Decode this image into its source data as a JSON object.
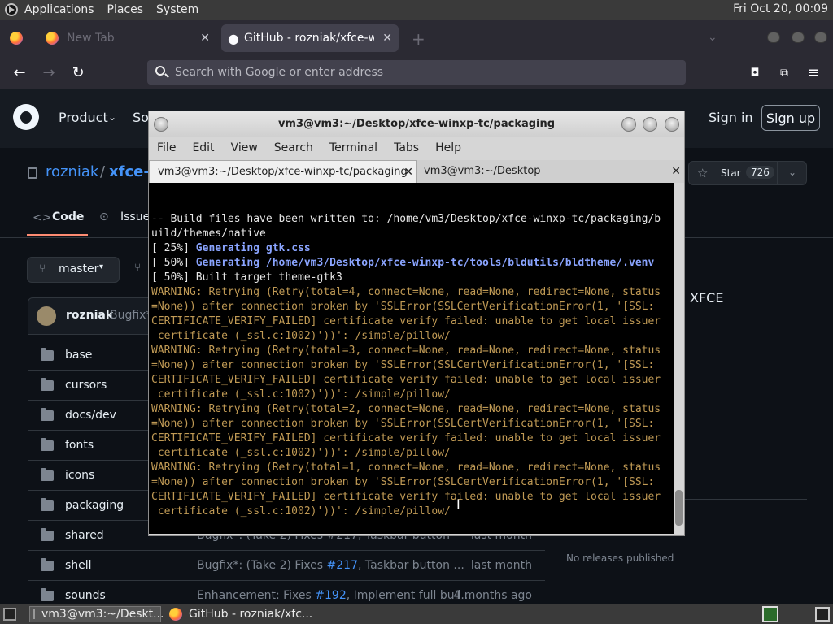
{
  "system_panel": {
    "menus": [
      "Applications",
      "Places",
      "System"
    ],
    "clock": "Fri Oct 20, 00:09"
  },
  "browser": {
    "tabs": [
      {
        "label": "New Tab"
      },
      {
        "label": "GitHub - rozniak/xfce-winxp"
      }
    ],
    "urlbar_placeholder": "Search with Google or enter address"
  },
  "github": {
    "nav": {
      "product": "Product",
      "solutions": "So",
      "sign_in": "Sign in",
      "sign_up": "Sign up"
    },
    "repo": {
      "owner": "rozniak",
      "sep": "/",
      "name": "xfce-"
    },
    "star": {
      "label": "Star",
      "count": "726"
    },
    "tabs": {
      "code": "Code",
      "issues": "Issue"
    },
    "branch": "master",
    "commit": {
      "author": "rozniak",
      "message": "Bugfix*:"
    },
    "about_fragment": "XFCE",
    "releases": "No releases published",
    "files": [
      {
        "name": "base",
        "msg": "",
        "when": ""
      },
      {
        "name": "cursors",
        "msg": "",
        "when": ""
      },
      {
        "name": "docs/dev",
        "msg": "",
        "when": ""
      },
      {
        "name": "fonts",
        "msg": "",
        "when": ""
      },
      {
        "name": "icons",
        "msg": "",
        "when": ""
      },
      {
        "name": "packaging",
        "msg": "",
        "when": ""
      },
      {
        "name": "shared",
        "msg": "Bugfix*: (Take 2) Fixes #217, Taskbar button",
        "when": "last month"
      },
      {
        "name": "shell",
        "msg_pre": "Bugfix*: (Take 2) Fixes ",
        "msg_link": "#217",
        "msg_post": ", Taskbar button ...",
        "when": "last month"
      },
      {
        "name": "sounds",
        "msg_pre": "Enhancement: Fixes ",
        "msg_link": "#192",
        "msg_post": ", Implement full buil...",
        "when": "4 months ago"
      }
    ]
  },
  "terminal": {
    "title": "vm3@vm3:~/Desktop/xfce-winxp-tc/packaging",
    "menu": [
      "File",
      "Edit",
      "View",
      "Search",
      "Terminal",
      "Tabs",
      "Help"
    ],
    "tabs": [
      "vm3@vm3:~/Desktop/xfce-winxp-tc/packaging",
      "vm3@vm3:~/Desktop"
    ],
    "lines": [
      {
        "t": "",
        "c": ""
      },
      {
        "t": "",
        "c": ""
      },
      {
        "t": "-- Build files have been written to: /home/vm3/Desktop/xfce-winxp-tc/packaging/b",
        "c": ""
      },
      {
        "t": "uild/themes/native",
        "c": ""
      },
      {
        "t": "[ 25%] ",
        "g": "Generating gtk.css",
        "c": ""
      },
      {
        "t": "[ 50%] ",
        "g": "Generating /home/vm3/Desktop/xfce-winxp-tc/tools/bldutils/bldtheme/.venv",
        "c": ""
      },
      {
        "t": "[ 50%] Built target theme-gtk3",
        "c": ""
      },
      {
        "t": "WARNING: Retrying (Retry(total=4, connect=None, read=None, redirect=None, status",
        "c": "warn"
      },
      {
        "t": "=None)) after connection broken by 'SSLError(SSLCertVerificationError(1, '[SSL:",
        "c": "warn"
      },
      {
        "t": "CERTIFICATE_VERIFY_FAILED] certificate verify failed: unable to get local issuer",
        "c": "warn"
      },
      {
        "t": " certificate (_ssl.c:1002)'))': /simple/pillow/",
        "c": "warn"
      },
      {
        "t": "WARNING: Retrying (Retry(total=3, connect=None, read=None, redirect=None, status",
        "c": "warn"
      },
      {
        "t": "=None)) after connection broken by 'SSLError(SSLCertVerificationError(1, '[SSL:",
        "c": "warn"
      },
      {
        "t": "CERTIFICATE_VERIFY_FAILED] certificate verify failed: unable to get local issuer",
        "c": "warn"
      },
      {
        "t": " certificate (_ssl.c:1002)'))': /simple/pillow/",
        "c": "warn"
      },
      {
        "t": "WARNING: Retrying (Retry(total=2, connect=None, read=None, redirect=None, status",
        "c": "warn"
      },
      {
        "t": "=None)) after connection broken by 'SSLError(SSLCertVerificationError(1, '[SSL:",
        "c": "warn"
      },
      {
        "t": "CERTIFICATE_VERIFY_FAILED] certificate verify failed: unable to get local issuer",
        "c": "warn"
      },
      {
        "t": " certificate (_ssl.c:1002)'))': /simple/pillow/",
        "c": "warn"
      },
      {
        "t": "WARNING: Retrying (Retry(total=1, connect=None, read=None, redirect=None, status",
        "c": "warn"
      },
      {
        "t": "=None)) after connection broken by 'SSLError(SSLCertVerificationError(1, '[SSL:",
        "c": "warn"
      },
      {
        "t": "CERTIFICATE_VERIFY_FAILED] certificate verify failed: unable to get local issuer",
        "c": "warn"
      },
      {
        "t": " certificate (_ssl.c:1002)'))': /simple/pillow/",
        "c": "warn"
      }
    ]
  },
  "taskbar": {
    "tasks": [
      "vm3@vm3:~/Deskt...",
      "GitHub - rozniak/xfc..."
    ]
  }
}
